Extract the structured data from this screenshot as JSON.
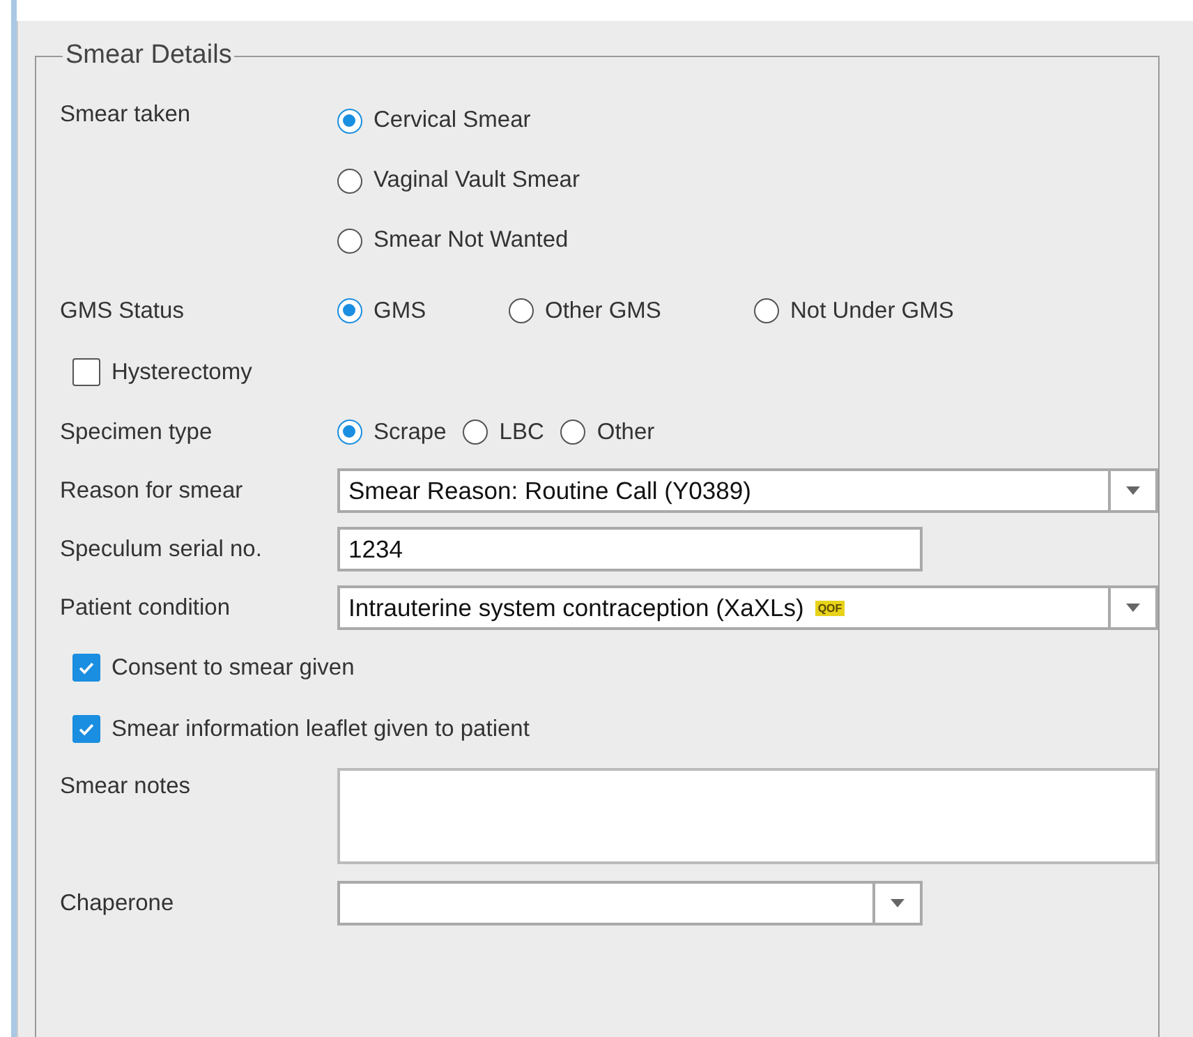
{
  "group": {
    "title": "Smear Details"
  },
  "fields": [
    {
      "kind": "radio_stack",
      "label": "Smear taken",
      "options": [
        {
          "label": "Cervical Smear",
          "selected": true
        },
        {
          "label": "Vaginal Vault Smear",
          "selected": false
        },
        {
          "label": "Smear Not Wanted",
          "selected": false
        }
      ]
    },
    {
      "kind": "radio_row",
      "label": "GMS Status",
      "options": [
        {
          "label": "GMS",
          "selected": true
        },
        {
          "label": "Other GMS",
          "selected": false
        },
        {
          "label": "Not Under GMS",
          "selected": false
        }
      ]
    },
    {
      "kind": "checkbox",
      "label": "Hysterectomy",
      "checked": false
    },
    {
      "kind": "radio_row_tight",
      "label": "Specimen type",
      "options": [
        {
          "label": "Scrape",
          "selected": true
        },
        {
          "label": "LBC",
          "selected": false
        },
        {
          "label": "Other",
          "selected": false
        }
      ]
    },
    {
      "kind": "dropdown",
      "label": "Reason for smear",
      "value": "Smear Reason: Routine Call (Y0389)"
    },
    {
      "kind": "text",
      "label": "Speculum serial no.",
      "value": "1234"
    },
    {
      "kind": "dropdown",
      "label": "Patient condition",
      "value": "Intrauterine system contraception (XaXLs)",
      "badge": "QOF"
    },
    {
      "kind": "checkbox",
      "label": "Consent to smear given",
      "checked": true
    },
    {
      "kind": "checkbox",
      "label": "Smear information leaflet given to patient",
      "checked": true
    },
    {
      "kind": "textarea",
      "label": "Smear notes"
    },
    {
      "kind": "dropdown_short",
      "label": "Chaperone"
    }
  ]
}
